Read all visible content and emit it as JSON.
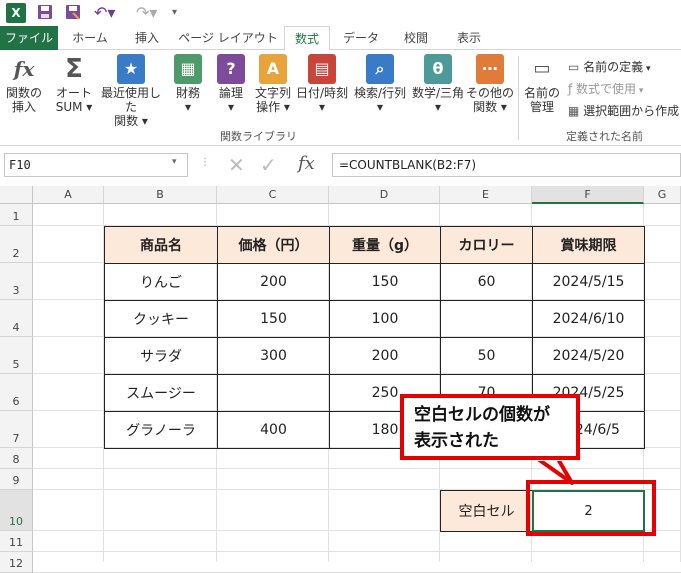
{
  "qat": {
    "undo_icon": "undo-icon",
    "redo_icon": "redo-icon"
  },
  "tabs": [
    {
      "label": "ファイル"
    },
    {
      "label": "ホーム"
    },
    {
      "label": "挿入"
    },
    {
      "label": "ページ レイアウト"
    },
    {
      "label": "数式"
    },
    {
      "label": "データ"
    },
    {
      "label": "校閲"
    },
    {
      "label": "表示"
    }
  ],
  "ribbon": {
    "buttons": [
      {
        "label1": "関数の",
        "label2": "挿入",
        "icon": "fx-icon"
      },
      {
        "label1": "オート",
        "label2": "SUM ▾",
        "icon": "sigma-icon"
      },
      {
        "label1": "最近使用した",
        "label2": "関数 ▾",
        "icon": "star-icon"
      },
      {
        "label1": "財務",
        "label2": "▾",
        "icon": "finance-icon"
      },
      {
        "label1": "論理",
        "label2": "▾",
        "icon": "logic-icon"
      },
      {
        "label1": "文字列",
        "label2": "操作 ▾",
        "icon": "text-icon"
      },
      {
        "label1": "日付/時刻",
        "label2": "▾",
        "icon": "calendar-icon"
      },
      {
        "label1": "検索/行列",
        "label2": "▾",
        "icon": "lookup-icon"
      },
      {
        "label1": "数学/三角",
        "label2": "▾",
        "icon": "math-icon"
      },
      {
        "label1": "その他の",
        "label2": "関数 ▾",
        "icon": "more-icon"
      }
    ],
    "group1_label": "関数ライブラリ",
    "name_manager": {
      "label1": "名前の",
      "label2": "管理"
    },
    "define_name": "名前の定義",
    "use_in_formula": "数式で使用",
    "create_from_selection": "選択範囲から作成",
    "group2_label": "定義された名前"
  },
  "formula_bar": {
    "name_box": "F10",
    "formula": "=COUNTBLANK(B2:F7)"
  },
  "columns": [
    "A",
    "B",
    "C",
    "D",
    "E",
    "F",
    "G"
  ],
  "rows": [
    "1",
    "2",
    "3",
    "4",
    "5",
    "6",
    "7",
    "8",
    "9",
    "10",
    "11",
    "12"
  ],
  "table": {
    "headers": [
      "商品名",
      "価格（円）",
      "重量（g）",
      "カロリー",
      "賞味期限"
    ],
    "rows": [
      [
        "りんご",
        "200",
        "150",
        "60",
        "2024/5/15"
      ],
      [
        "クッキー",
        "150",
        "100",
        "",
        "2024/6/10"
      ],
      [
        "サラダ",
        "300",
        "200",
        "50",
        "2024/5/20"
      ],
      [
        "スムージー",
        "",
        "250",
        "70",
        "2024/5/25"
      ],
      [
        "グラノーラ",
        "400",
        "180",
        "",
        "2024/6/5"
      ]
    ]
  },
  "result": {
    "label": "空白セル",
    "value": "2"
  },
  "callout": {
    "line1": "空白セルの個数が",
    "line2": "表示された"
  }
}
